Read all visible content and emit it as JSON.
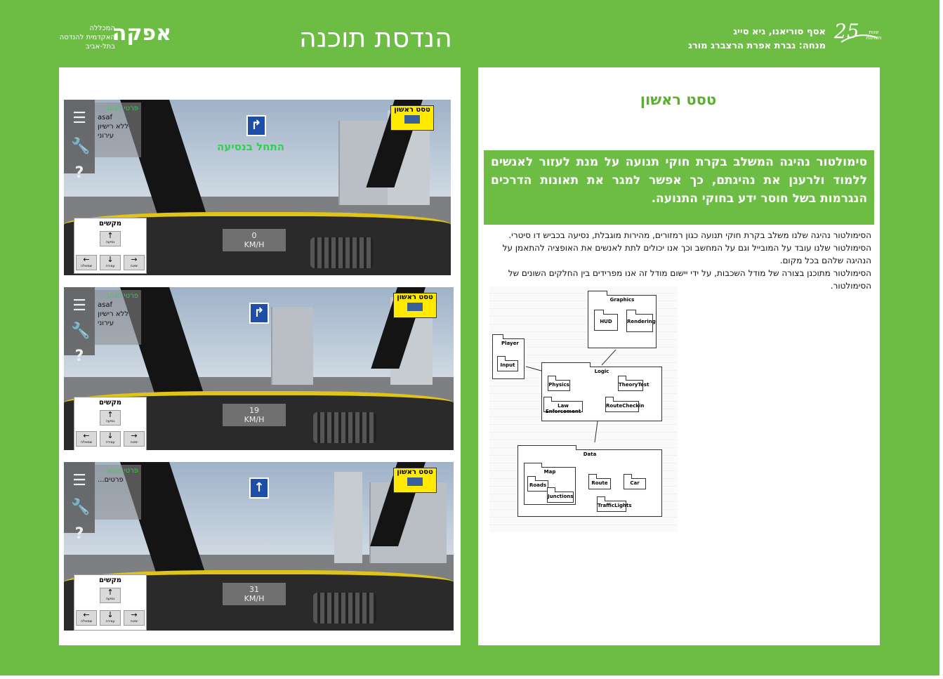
{
  "header": {
    "title": "הנדסת תוכנה",
    "afeka_logo": "אפקה",
    "afeka_sub": "המכללה האקדמית להנדסה בתל-אביב",
    "authors": "אסף סוריאנו, גיא סייג",
    "supervisor": "מנחה: גברת אפרת הרצברג מורג",
    "anniversary_number": "25",
    "anniversary_text": "שנות מצוינות"
  },
  "screenshots": [
    {
      "driver_header": "פרטי הנהג",
      "driver_lines": [
        "asaf",
        "ללא רישיון",
        "עירוני"
      ],
      "test_label": "טסט ראשון",
      "sign": "↱",
      "start_text": "התחל בנסיעה",
      "speed": "0",
      "speed_unit": "KM/H",
      "keys_label": "מקשים",
      "keys": [
        "↑",
        "←",
        "↓",
        "→"
      ],
      "key_captions": [
        "נסיעה",
        "שמאלה",
        "עצירה",
        "ימינה"
      ]
    },
    {
      "driver_header": "פרטי הנהג",
      "driver_lines": [
        "asaf",
        "ללא רישיון",
        "עירוני"
      ],
      "test_label": "טסט ראשון",
      "sign": "↱",
      "start_text": "",
      "speed": "19",
      "speed_unit": "KM/H",
      "keys_label": "מקשים",
      "keys": [
        "↑",
        "←",
        "↓",
        "→"
      ],
      "key_captions": [
        "נסיעה",
        "שמאלה",
        "עצירה",
        "ימינה"
      ]
    },
    {
      "driver_header": "פרטי הנהג",
      "driver_lines": [
        "פרטים..."
      ],
      "test_label": "טסט ראשון",
      "sign": "↑",
      "start_text": "",
      "speed": "31",
      "speed_unit": "KM/H",
      "keys_label": "מקשים",
      "keys": [
        "↑",
        "←",
        "↓",
        "→"
      ],
      "key_captions": [
        "נסיעה",
        "שמאלה",
        "עצירה",
        "ימינה"
      ]
    }
  ],
  "right": {
    "title": "טסט ראשון",
    "intro": "סימולטור נהיגה המשלב בקרת חוקי תנועה על מנת לעזור לאנשים ללמוד ולרענן את נהיגתם, כך אפשר למגר את תאונות הדרכים הנגרמות בשל חוסר ידע בחוקי התנועה.",
    "paragraph1": "הסימולטור נהיגה שלנו משלב בקרת חוקי תנועה כגון רמזורים, מהירות מוגבלת, נסיעה בכביש דו סיטרי. הסימולטור שלנו עובד על המובייל וגם על המחשב וכך אנו יכולים לתת לאנשים את האופציה להתאמן על הנהיגה שלהם בכל מקום.",
    "paragraph2": "הסימולטור מתוכנן בצורה של מודל השכבות, על ידי יישום מודל זה אנו מפרידים בין החלקים השונים של הסימולטור."
  },
  "diagram": {
    "packages": {
      "graphics": "Graphics",
      "hud": "HUD",
      "rendering": "Rendering",
      "player": "Player",
      "input": "Input",
      "logic": "Logic",
      "physics": "Physics",
      "theory": "TheoryTest",
      "law": "Law Enforcement",
      "route_checkin": "RouteCheckin",
      "data": "Data",
      "map": "Map",
      "roads": "Roads",
      "junctions": "Junctions",
      "route": "Route",
      "car": "Car",
      "traffic": "TrafficLights"
    }
  },
  "colors": {
    "brand_green": "#6dbd45",
    "title_green": "#5cae32",
    "test_yellow": "#ffea00",
    "sign_blue": "#1f4ea8"
  }
}
